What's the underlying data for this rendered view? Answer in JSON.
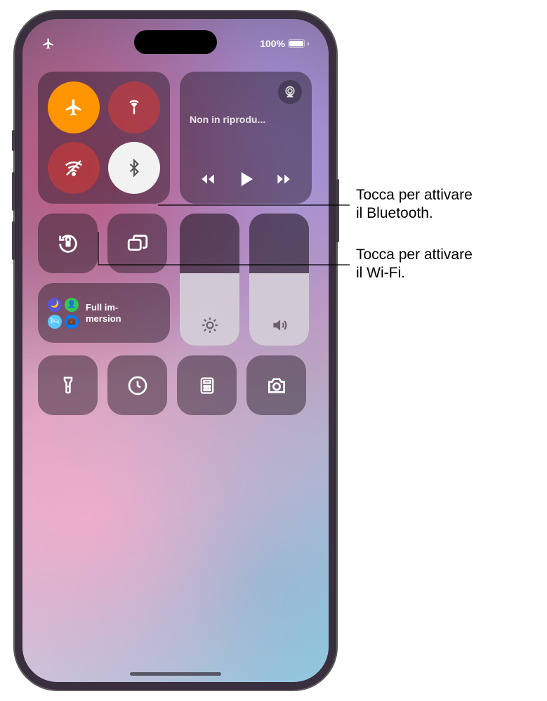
{
  "status": {
    "battery_pct": "100%"
  },
  "media": {
    "title": "Non in riprodu..."
  },
  "focus": {
    "label": "Full im-\nmersion"
  },
  "sliders": {
    "brightness_pct": 55,
    "volume_pct": 55
  },
  "callouts": {
    "bluetooth": "Tocca per attivare\nil Bluetooth.",
    "wifi": "Tocca per attivare\nil Wi-Fi."
  },
  "icons": {
    "airplane": "airplane",
    "cellular": "cellular-antenna",
    "wifi_off": "wifi-off",
    "bluetooth": "bluetooth",
    "airplay": "airplay",
    "orientation_lock": "orientation-lock",
    "screen_mirroring": "screen-mirroring",
    "brightness": "brightness",
    "volume": "volume",
    "flashlight": "flashlight",
    "timer": "timer",
    "calculator": "calculator",
    "camera": "camera"
  }
}
